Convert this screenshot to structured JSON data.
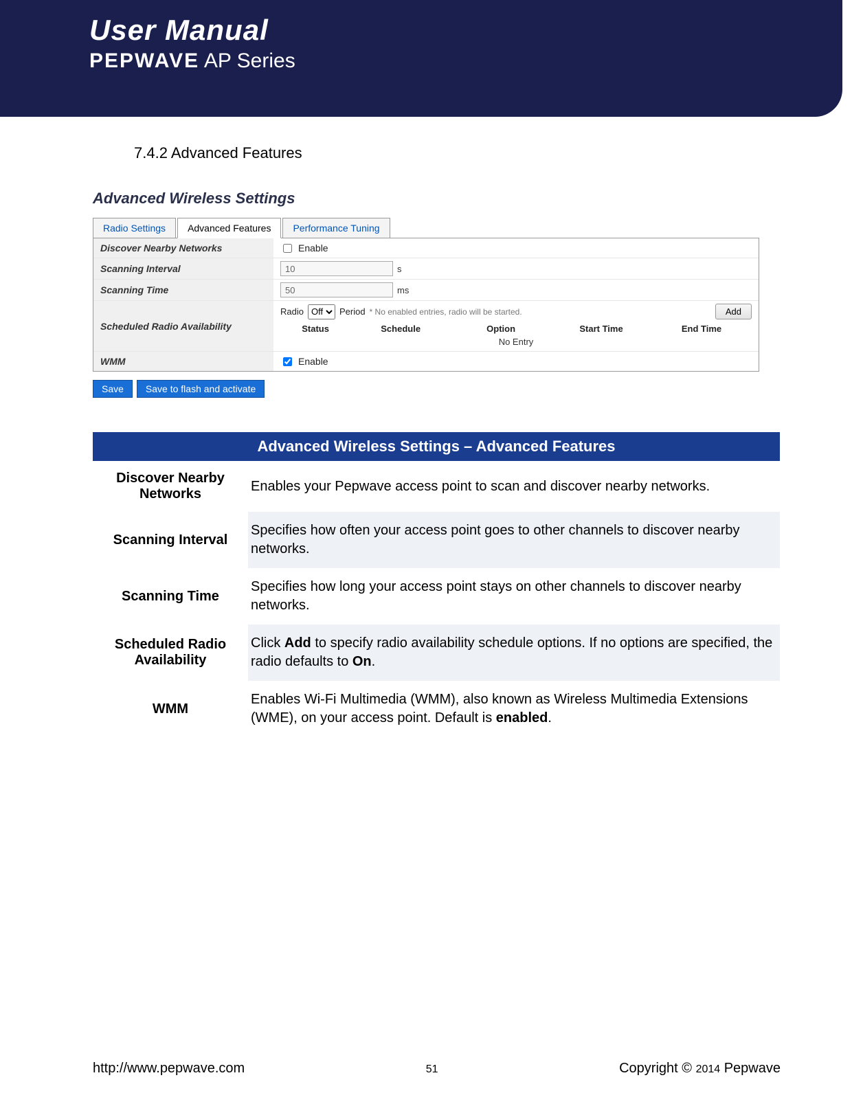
{
  "header": {
    "title": "User Manual",
    "brand": "PEPWAVE",
    "series": "AP Series"
  },
  "section": {
    "number": "7.4.2 Advanced Features"
  },
  "ui": {
    "heading": "Advanced Wireless Settings",
    "tabs": {
      "radio": "Radio Settings",
      "advanced": "Advanced Features",
      "perf": "Performance Tuning"
    },
    "rows": {
      "discover_label": "Discover Nearby Networks",
      "discover_enable": "Enable",
      "scan_interval_label": "Scanning Interval",
      "scan_interval_value": "10",
      "scan_interval_unit": "s",
      "scan_time_label": "Scanning Time",
      "scan_time_value": "50",
      "scan_time_unit": "ms",
      "sched_label": "Scheduled Radio Availability",
      "sched_radio_word": "Radio",
      "sched_radio_value": "Off",
      "sched_period_word": "Period",
      "sched_note": "* No enabled entries, radio will be started.",
      "sched_add": "Add",
      "sched_cols": {
        "status": "Status",
        "schedule": "Schedule",
        "option": "Option",
        "start": "Start Time",
        "end": "End Time"
      },
      "sched_empty": "No Entry",
      "wmm_label": "WMM",
      "wmm_enable": "Enable"
    },
    "buttons": {
      "save": "Save",
      "save_flash": "Save to flash and activate"
    }
  },
  "desc": {
    "title": "Advanced Wireless Settings – Advanced Features",
    "items": [
      {
        "term": "Discover Nearby Networks",
        "def_plain": "Enables your Pepwave access point to scan and discover nearby networks."
      },
      {
        "term": "Scanning Interval",
        "def_plain": "Specifies how often your access point goes to other channels to discover nearby networks."
      },
      {
        "term": "Scanning Time",
        "def_plain": "Specifies how long your access point stays on other channels to discover nearby networks."
      },
      {
        "term": "Scheduled Radio Availability",
        "def_pre": "Click ",
        "def_b1": "Add",
        "def_mid": " to specify radio availability schedule options. If no options are specified, the radio defaults to ",
        "def_b2": "On",
        "def_post": "."
      },
      {
        "term": "WMM",
        "def_pre": "Enables Wi-Fi Multimedia (WMM), also known as Wireless Multimedia Extensions (WME), on your access point. Default is ",
        "def_b1": "enabled",
        "def_post": "."
      }
    ]
  },
  "footer": {
    "url": "http://www.pepwave.com",
    "page": "51",
    "copyright_pre": "Copyright  ©  ",
    "copyright_year": "2014",
    "copyright_post": "  Pepwave"
  }
}
